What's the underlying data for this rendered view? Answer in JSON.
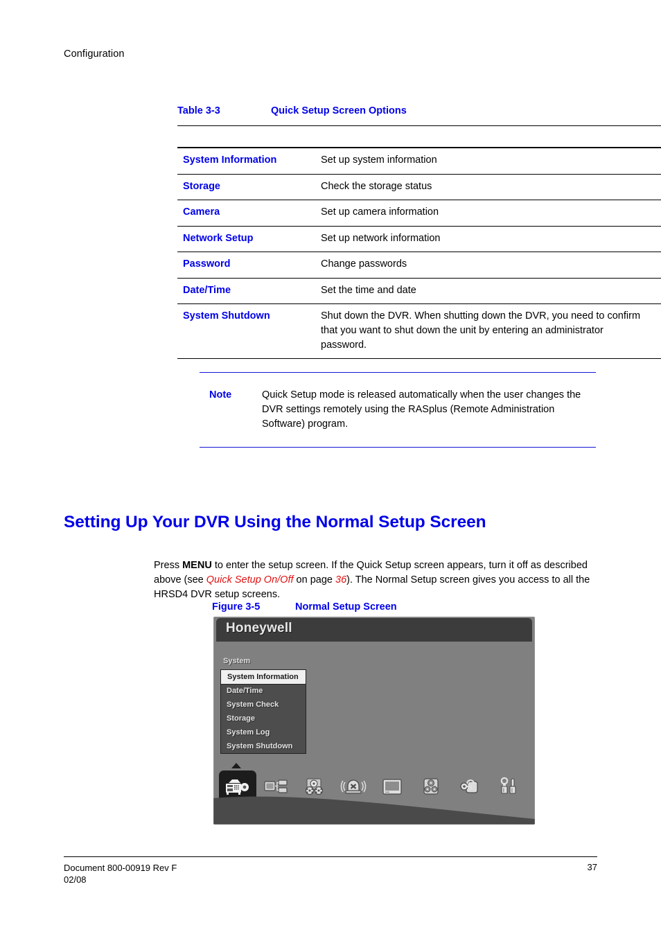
{
  "running_header": "Configuration",
  "table": {
    "caption_number": "Table 3-3",
    "caption_title": "Quick Setup Screen Options",
    "rows": [
      {
        "name": "System Information",
        "description": "Set up system information"
      },
      {
        "name": "Storage",
        "description": "Check the storage status"
      },
      {
        "name": "Camera",
        "description": "Set up camera information"
      },
      {
        "name": "Network Setup",
        "description": "Set up network information"
      },
      {
        "name": "Password",
        "description": "Change passwords"
      },
      {
        "name": "Date/Time",
        "description": "Set the time and date"
      },
      {
        "name": "System Shutdown",
        "description": "Shut down the DVR. When shutting down the DVR, you need to confirm that you want to shut down the unit by entering an administrator password."
      }
    ]
  },
  "note": {
    "label": "Note",
    "text": "Quick Setup mode is released automatically when the user changes the DVR settings remotely using the RASplus (Remote Administration Software) program."
  },
  "section": {
    "heading": "Setting Up Your DVR Using the Normal Setup Screen",
    "paragraph": {
      "part1": "Press ",
      "bold1": "MENU",
      "part2": " to enter the setup screen. If the Quick Setup screen appears, turn it off as described above (see ",
      "xref": "Quick Setup On/Off",
      "part3": " on page ",
      "xref_page": "36",
      "part4": "). The Normal Setup screen gives you access to all the HRSD4 DVR setup screens."
    }
  },
  "figure": {
    "caption_number": "Figure 3-5",
    "caption_title": "Normal Setup Screen",
    "dvr": {
      "logo": "Honeywell",
      "menu_group_label": "System",
      "menu_items": [
        "System Information",
        "Date/Time",
        "System Check",
        "Storage",
        "System Log",
        "System Shutdown"
      ],
      "selected_menu_item": "System Information",
      "toolbar_icons": [
        "dvr-system-icon",
        "network-icon",
        "record-icon",
        "alarm-icon",
        "display-icon",
        "event-icon",
        "password-lock-icon",
        "tools-icon"
      ],
      "selected_toolbar_icon": "dvr-system-icon"
    }
  },
  "footer": {
    "document": "Document 800-00919 Rev F",
    "date": "02/08",
    "page_number": "37"
  },
  "colors": {
    "accent_blue": "#0000e8",
    "xref_red": "#e01010",
    "dvr_background": "#808080",
    "dvr_header": "#3c3c3c"
  }
}
